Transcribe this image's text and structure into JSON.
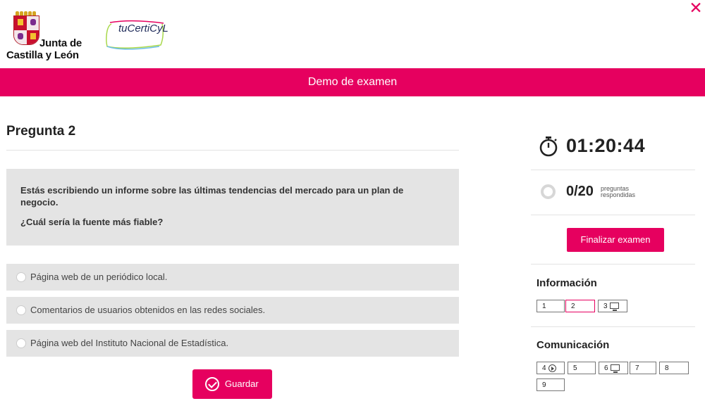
{
  "header": {
    "org_logo_line1": "Junta de",
    "org_logo_line2": "Castilla y León",
    "brand_logo_text": "tuCertiCyL",
    "close_symbol": "✕"
  },
  "title_bar": {
    "title": "Demo de examen"
  },
  "question": {
    "number_label": "Pregunta 2",
    "text": "Estás escribiendo un informe sobre las últimas tendencias del mercado para un plan de negocio.",
    "ask": "¿Cuál sería la fuente más fiable?",
    "options": [
      {
        "label": "Página web de un periódico local.",
        "selected": false
      },
      {
        "label": "Comentarios de usuarios obtenidos en las redes sociales.",
        "selected": false
      },
      {
        "label": "Página web del Instituto Nacional de Estadística.",
        "selected": false
      }
    ],
    "save_label": "Guardar"
  },
  "sidebar": {
    "timer": "01:20:44",
    "progress": {
      "answered": "0/20",
      "unit_line1": "preguntas",
      "unit_line2": "respondidas",
      "fraction": 0
    },
    "finish_label": "Finalizar examen",
    "sections": [
      {
        "title": "Información",
        "questions": [
          {
            "num": "1",
            "icon": "",
            "active": false
          },
          {
            "num": "2",
            "icon": "",
            "active": true
          },
          {
            "num": "3",
            "icon": "monitor-icon",
            "active": false
          }
        ]
      },
      {
        "title": "Comunicación",
        "questions": [
          {
            "num": "4",
            "icon": "play-icon",
            "active": false
          },
          {
            "num": "5",
            "icon": "",
            "active": false
          },
          {
            "num": "6",
            "icon": "monitor-icon",
            "active": false
          },
          {
            "num": "7",
            "icon": "",
            "active": false
          },
          {
            "num": "8",
            "icon": "",
            "active": false
          },
          {
            "num": "9",
            "icon": "",
            "active": false
          }
        ]
      }
    ]
  },
  "colors": {
    "accent": "#e6005f",
    "panel": "#e4e4e4"
  }
}
